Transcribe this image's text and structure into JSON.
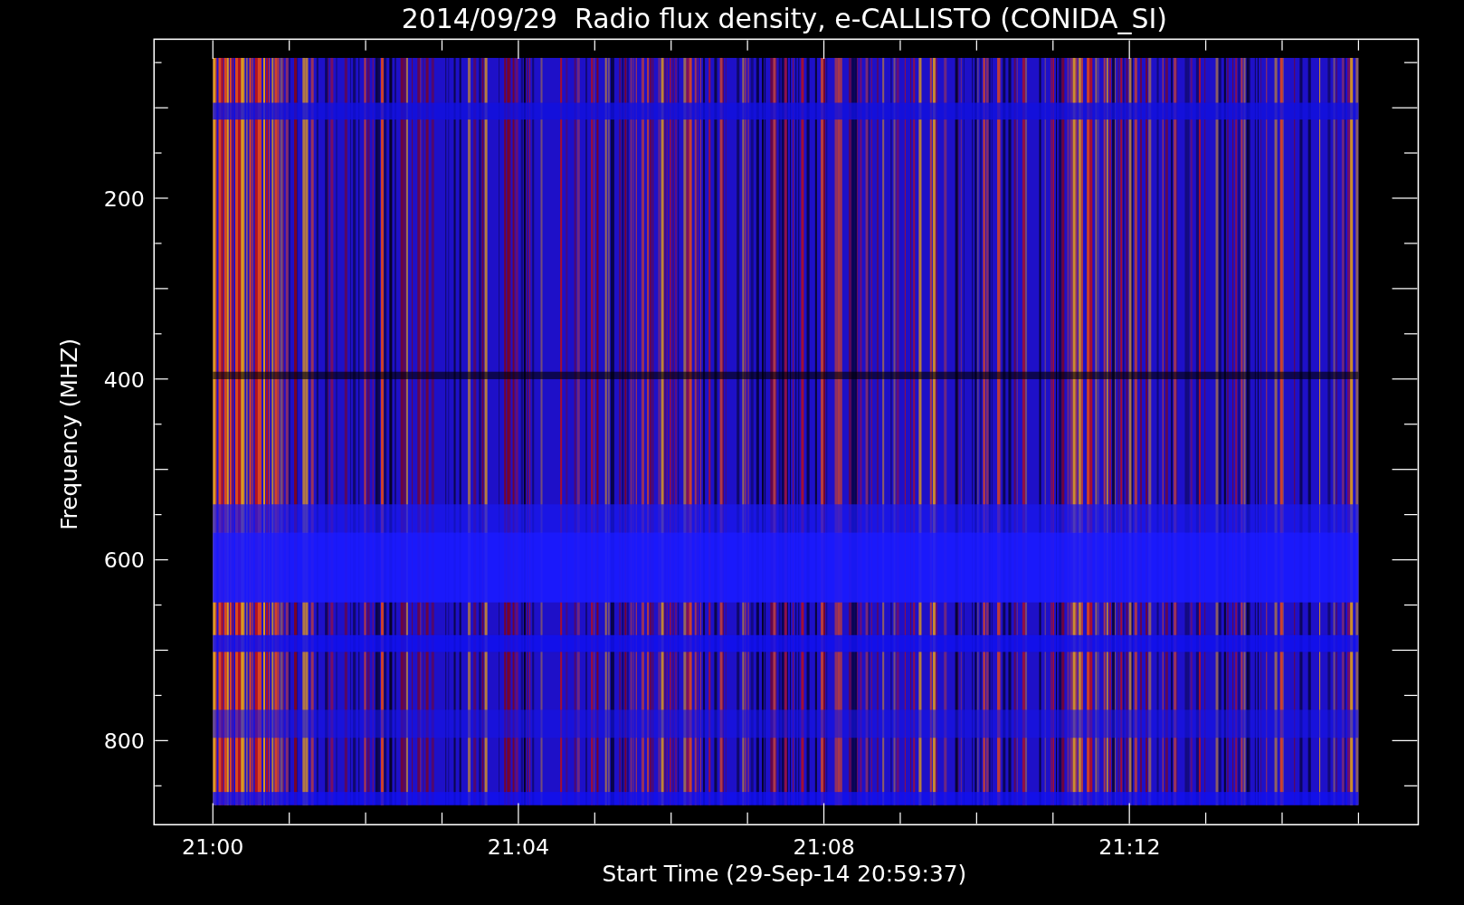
{
  "title": "2014/09/29  Radio flux density, e-CALLISTO (CONIDA_SI)",
  "y_axis": {
    "label": "Frequency (MHZ)",
    "ticks": [
      "200",
      "400",
      "600",
      "800"
    ]
  },
  "x_axis": {
    "label": "Start Time (29-Sep-14 20:59:37)",
    "ticks": [
      "21:00",
      "21:04",
      "21:08",
      "21:12"
    ]
  }
}
